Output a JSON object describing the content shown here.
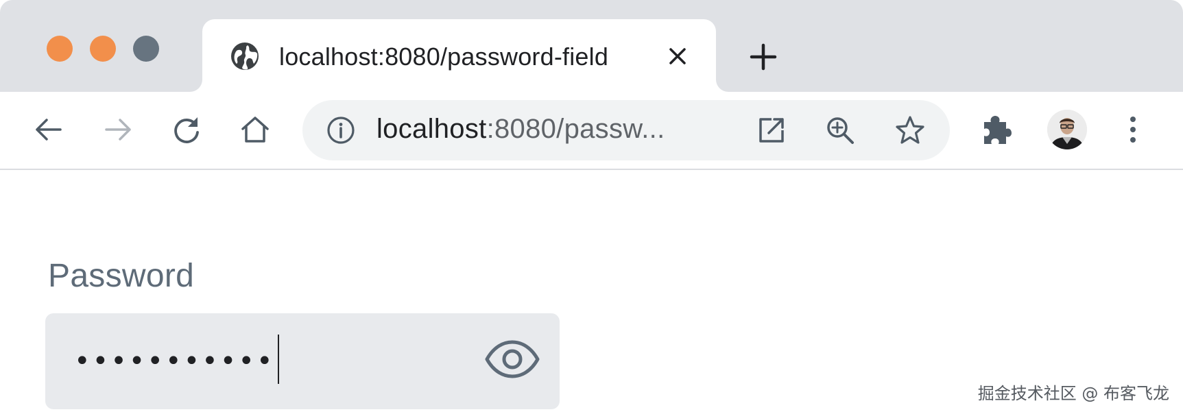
{
  "window_controls": {
    "close": {
      "icon": "close-dot",
      "color": "#f28f4b"
    },
    "minimize": {
      "icon": "minimize-dot",
      "color": "#f28f4b"
    },
    "maximize": {
      "icon": "maximize-dot",
      "color": "#677480"
    }
  },
  "tab": {
    "title": "localhost:8080/password-field",
    "favicon": "globe-icon",
    "close_icon": "close-icon"
  },
  "new_tab_icon": "plus-icon",
  "toolbar": {
    "back_icon": "arrow-left-icon",
    "forward_icon": "arrow-right-icon",
    "reload_icon": "reload-icon",
    "home_icon": "home-icon",
    "extensions_icon": "puzzle-icon",
    "menu_icon": "kebab-menu-icon"
  },
  "omnibox": {
    "host": "localhost",
    "rest": ":8080/passw...",
    "info_icon": "info-icon",
    "open_icon": "open-external-icon",
    "zoom_icon": "zoom-in-icon",
    "star_icon": "star-icon"
  },
  "form": {
    "label": "Password",
    "value": "•••••••••••",
    "toggle_icon": "eye-icon"
  },
  "watermark": "掘金技术社区 @ 布客飞龙",
  "colors": {
    "tabstrip_bg": "#dfe1e5",
    "omnibox_bg": "#f1f3f4",
    "field_bg": "#e8eaed",
    "label": "#5e6b78",
    "icon": "#4f5b66"
  }
}
